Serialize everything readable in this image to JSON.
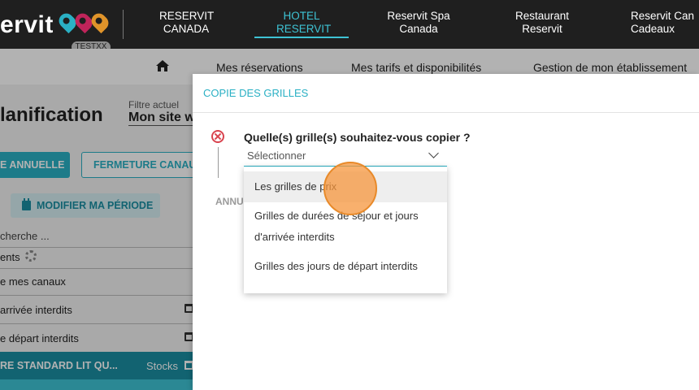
{
  "topbar": {
    "logo_text": "ervit",
    "logo_badge": "TESTXX",
    "nav": [
      {
        "label": "RESERVIT\nCANADA"
      },
      {
        "label": "HOTEL\nRESERVIT"
      },
      {
        "label": "Reservit Spa\nCanada"
      },
      {
        "label": "Restaurant\nReservit"
      },
      {
        "label": "Reservit Can\nCadeaux"
      }
    ]
  },
  "subnav": {
    "items": [
      "Mes réservations",
      "Mes tarifs et disponibilités",
      "Gestion de mon établissement"
    ]
  },
  "page": {
    "title": "lanification",
    "filter_label": "Filtre actuel",
    "filter_value": "Mon site w",
    "btn_annual": "E ANNUELLE",
    "btn_fermeture": "FERMETURE CANAUX",
    "btn_periode": "MODIFIER MA PÉRIODE",
    "search": "cherche ...",
    "rows": [
      "ents",
      "e mes canaux",
      "arrivée interdits",
      "e départ interdits"
    ],
    "dark_row_title": "RE STANDARD LIT QU...",
    "dark_row_stocks": "Stocks"
  },
  "dialog": {
    "title": "COPIE DES GRILLES",
    "question": "Quelle(s) grille(s) souhaitez-vous copier ?",
    "select_placeholder": "Sélectionner",
    "cancel_label": "ANNU",
    "options": [
      "Les grilles de prix",
      "Grilles de durées de séjour et jours d'arrivée interdits",
      "Grilles des jours de départ interdits"
    ]
  },
  "colors": {
    "accent": "#2ab0c4",
    "topbar": "#1f1f1f",
    "error": "#d9434e"
  }
}
